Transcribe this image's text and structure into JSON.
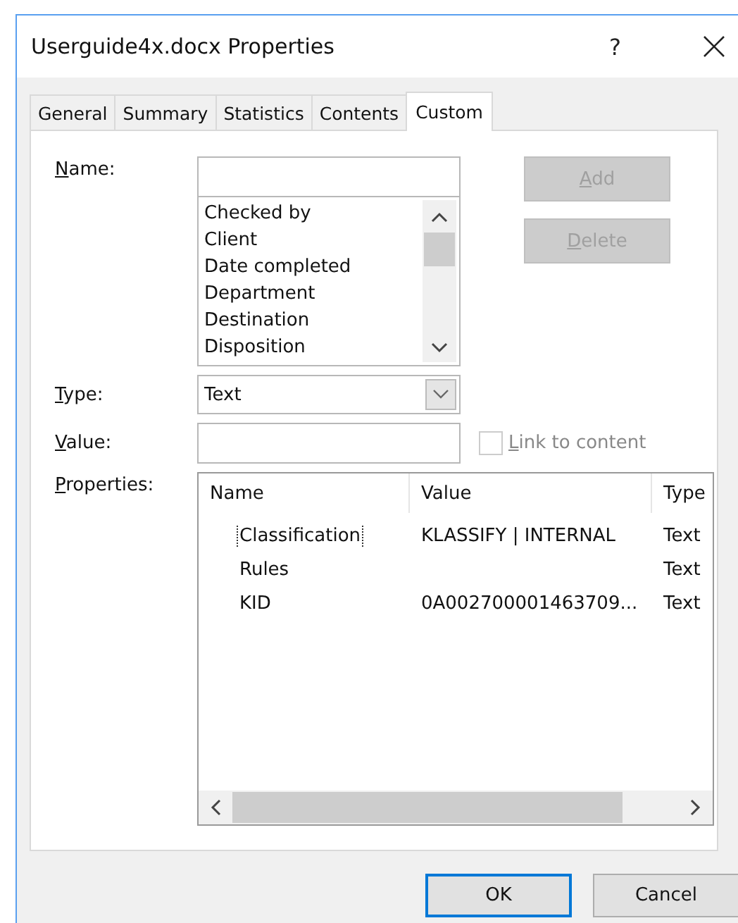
{
  "window": {
    "title": "Userguide4x.docx Properties",
    "help": "?"
  },
  "tabs": [
    {
      "label": "General",
      "selected": false
    },
    {
      "label": "Summary",
      "selected": false
    },
    {
      "label": "Statistics",
      "selected": false
    },
    {
      "label": "Contents",
      "selected": false
    },
    {
      "label": "Custom",
      "selected": true
    }
  ],
  "name_field": {
    "label": "Name:"
  },
  "name_list": [
    "Checked by",
    "Client",
    "Date completed",
    "Department",
    "Destination",
    "Disposition"
  ],
  "buttons_side": [
    {
      "label": "Add",
      "disabled": true
    },
    {
      "label": "Delete",
      "disabled": true
    }
  ],
  "type_field": {
    "label": "Type:",
    "value": "Text"
  },
  "value_field": {
    "label": "Value:"
  },
  "link_to_content": {
    "label": "Link to content",
    "checked": false,
    "disabled": true
  },
  "properties": {
    "label": "Properties:",
    "columns": [
      "Name",
      "Value",
      "Type"
    ],
    "rows": [
      {
        "name": "Classification",
        "value": "KLASSIFY | INTERNAL",
        "type": "Text",
        "focused": true
      },
      {
        "name": "Rules",
        "value": "",
        "type": "Text",
        "focused": false
      },
      {
        "name": "KID",
        "value": "0A002700001463709...",
        "type": "Text",
        "focused": false
      }
    ]
  },
  "buttons": [
    {
      "label": "OK",
      "default": true
    },
    {
      "label": "Cancel",
      "default": false
    }
  ]
}
